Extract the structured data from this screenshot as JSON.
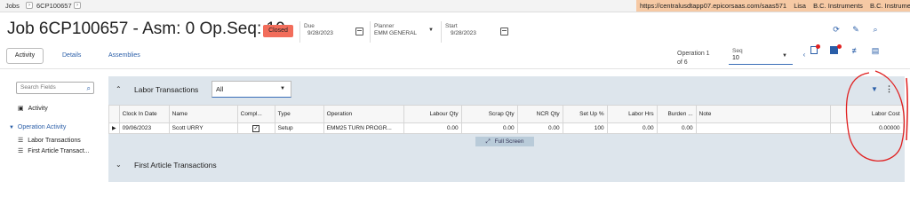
{
  "breadcrumb": {
    "root": "Jobs",
    "current": "6CP100657"
  },
  "browser": {
    "url": "https://centralusdtapp07.epicorsaas.com/saas571",
    "user": "Lisa",
    "company": "B.C. Instruments",
    "site": "B.C. Instruments"
  },
  "header": {
    "title": "Job 6CP100657 - Asm: 0 Op.Seq: 10",
    "status": "Closed",
    "due": {
      "label": "Due",
      "value": "9/28/2023"
    },
    "planner": {
      "label": "Planner",
      "value": "EMM GENERAL"
    },
    "start": {
      "label": "Start",
      "value": "9/28/2023"
    }
  },
  "tabs": [
    "Activity",
    "Details",
    "Assemblies"
  ],
  "operation": {
    "line1": "Operation 1",
    "line2": "of 6",
    "seq_label": "Seq",
    "seq_value": "10"
  },
  "sidebar": {
    "search_placeholder": "Search Fields",
    "items": [
      {
        "label": "Activity"
      },
      {
        "label": "Operation Activity"
      },
      {
        "label": "Labor Transactions"
      },
      {
        "label": "First Article Transact..."
      }
    ]
  },
  "labor_panel": {
    "title": "Labor Transactions",
    "filter_value": "All",
    "columns": [
      "Clock In Date",
      "Name",
      "Compl...",
      "Type",
      "Operation",
      "Labour Qty",
      "Scrap Qty",
      "NCR Qty",
      "Set Up %",
      "Labor Hrs",
      "Burden ...",
      "Note",
      "Labor Cost"
    ],
    "rows": [
      {
        "clock_in_date": "09/06/2023",
        "name": "Scott URRY",
        "complete": "☑",
        "type": "Setup",
        "operation": "EMM25 TURN PROGR...",
        "labour_qty": "0.00",
        "scrap_qty": "0.00",
        "ncr_qty": "0.00",
        "setup_pct": "100",
        "labor_hrs": "0.00",
        "burden": "0.00",
        "note": "",
        "labor_cost": "0.00000"
      }
    ],
    "full_screen_label": "Full Screen"
  },
  "first_article_panel": {
    "title": "First Article Transactions"
  },
  "colors": {
    "accent": "#2a5ea8",
    "closed_badge": "#f26d5b",
    "panel_bg": "#dde5ec",
    "url_bar": "#f6c9a4",
    "annotation": "#e02020"
  },
  "icons": [
    "refresh-icon",
    "clean-icon",
    "search-icon",
    "new-doc-icon",
    "panel-icon",
    "sliders-icon",
    "print-icon",
    "filter-icon",
    "more-vertical-icon",
    "calendar-icon",
    "expand-icon"
  ]
}
